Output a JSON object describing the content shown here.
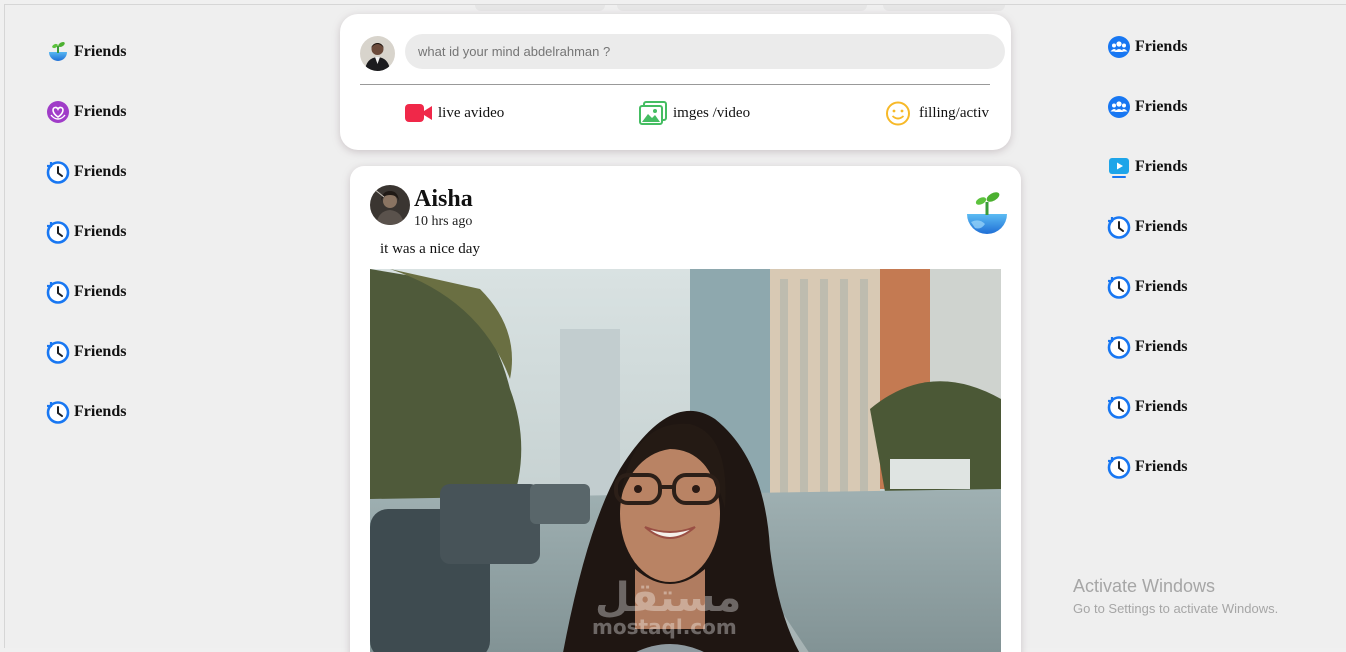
{
  "left_nav": [
    {
      "label": "Friends",
      "icon": "globe-sprout-icon"
    },
    {
      "label": "Friends",
      "icon": "heart-hands-icon"
    },
    {
      "label": "Friends",
      "icon": "history-clock-icon"
    },
    {
      "label": "Friends",
      "icon": "history-clock-icon"
    },
    {
      "label": "Friends",
      "icon": "history-clock-icon"
    },
    {
      "label": "Friends",
      "icon": "history-clock-icon"
    },
    {
      "label": "Friends",
      "icon": "history-clock-icon"
    }
  ],
  "right_nav": [
    {
      "label": "Friends",
      "icon": "groups-icon"
    },
    {
      "label": "Friends",
      "icon": "groups-icon"
    },
    {
      "label": "Friends",
      "icon": "video-play-icon"
    },
    {
      "label": "Friends",
      "icon": "history-clock-icon"
    },
    {
      "label": "Friends",
      "icon": "history-clock-icon"
    },
    {
      "label": "Friends",
      "icon": "history-clock-icon"
    },
    {
      "label": "Friends",
      "icon": "history-clock-icon"
    },
    {
      "label": "Friends",
      "icon": "history-clock-icon"
    }
  ],
  "composer": {
    "placeholder": "what id your mind abdelrahman ?",
    "actions": {
      "live": "live avideo",
      "images": "imges /video",
      "feeling": "filling/activ"
    }
  },
  "post": {
    "author": "Aisha",
    "time": "10 hrs ago",
    "caption": "it was a nice day"
  },
  "windows_notice": {
    "title": "Activate Windows",
    "subtitle": "Go to Settings to activate Windows."
  },
  "colors": {
    "accent_blue": "#1877f2",
    "live_red": "#f02849",
    "photo_green": "#45bd62",
    "feeling_yellow": "#f7b928",
    "heart_purple": "#a03cc8"
  }
}
